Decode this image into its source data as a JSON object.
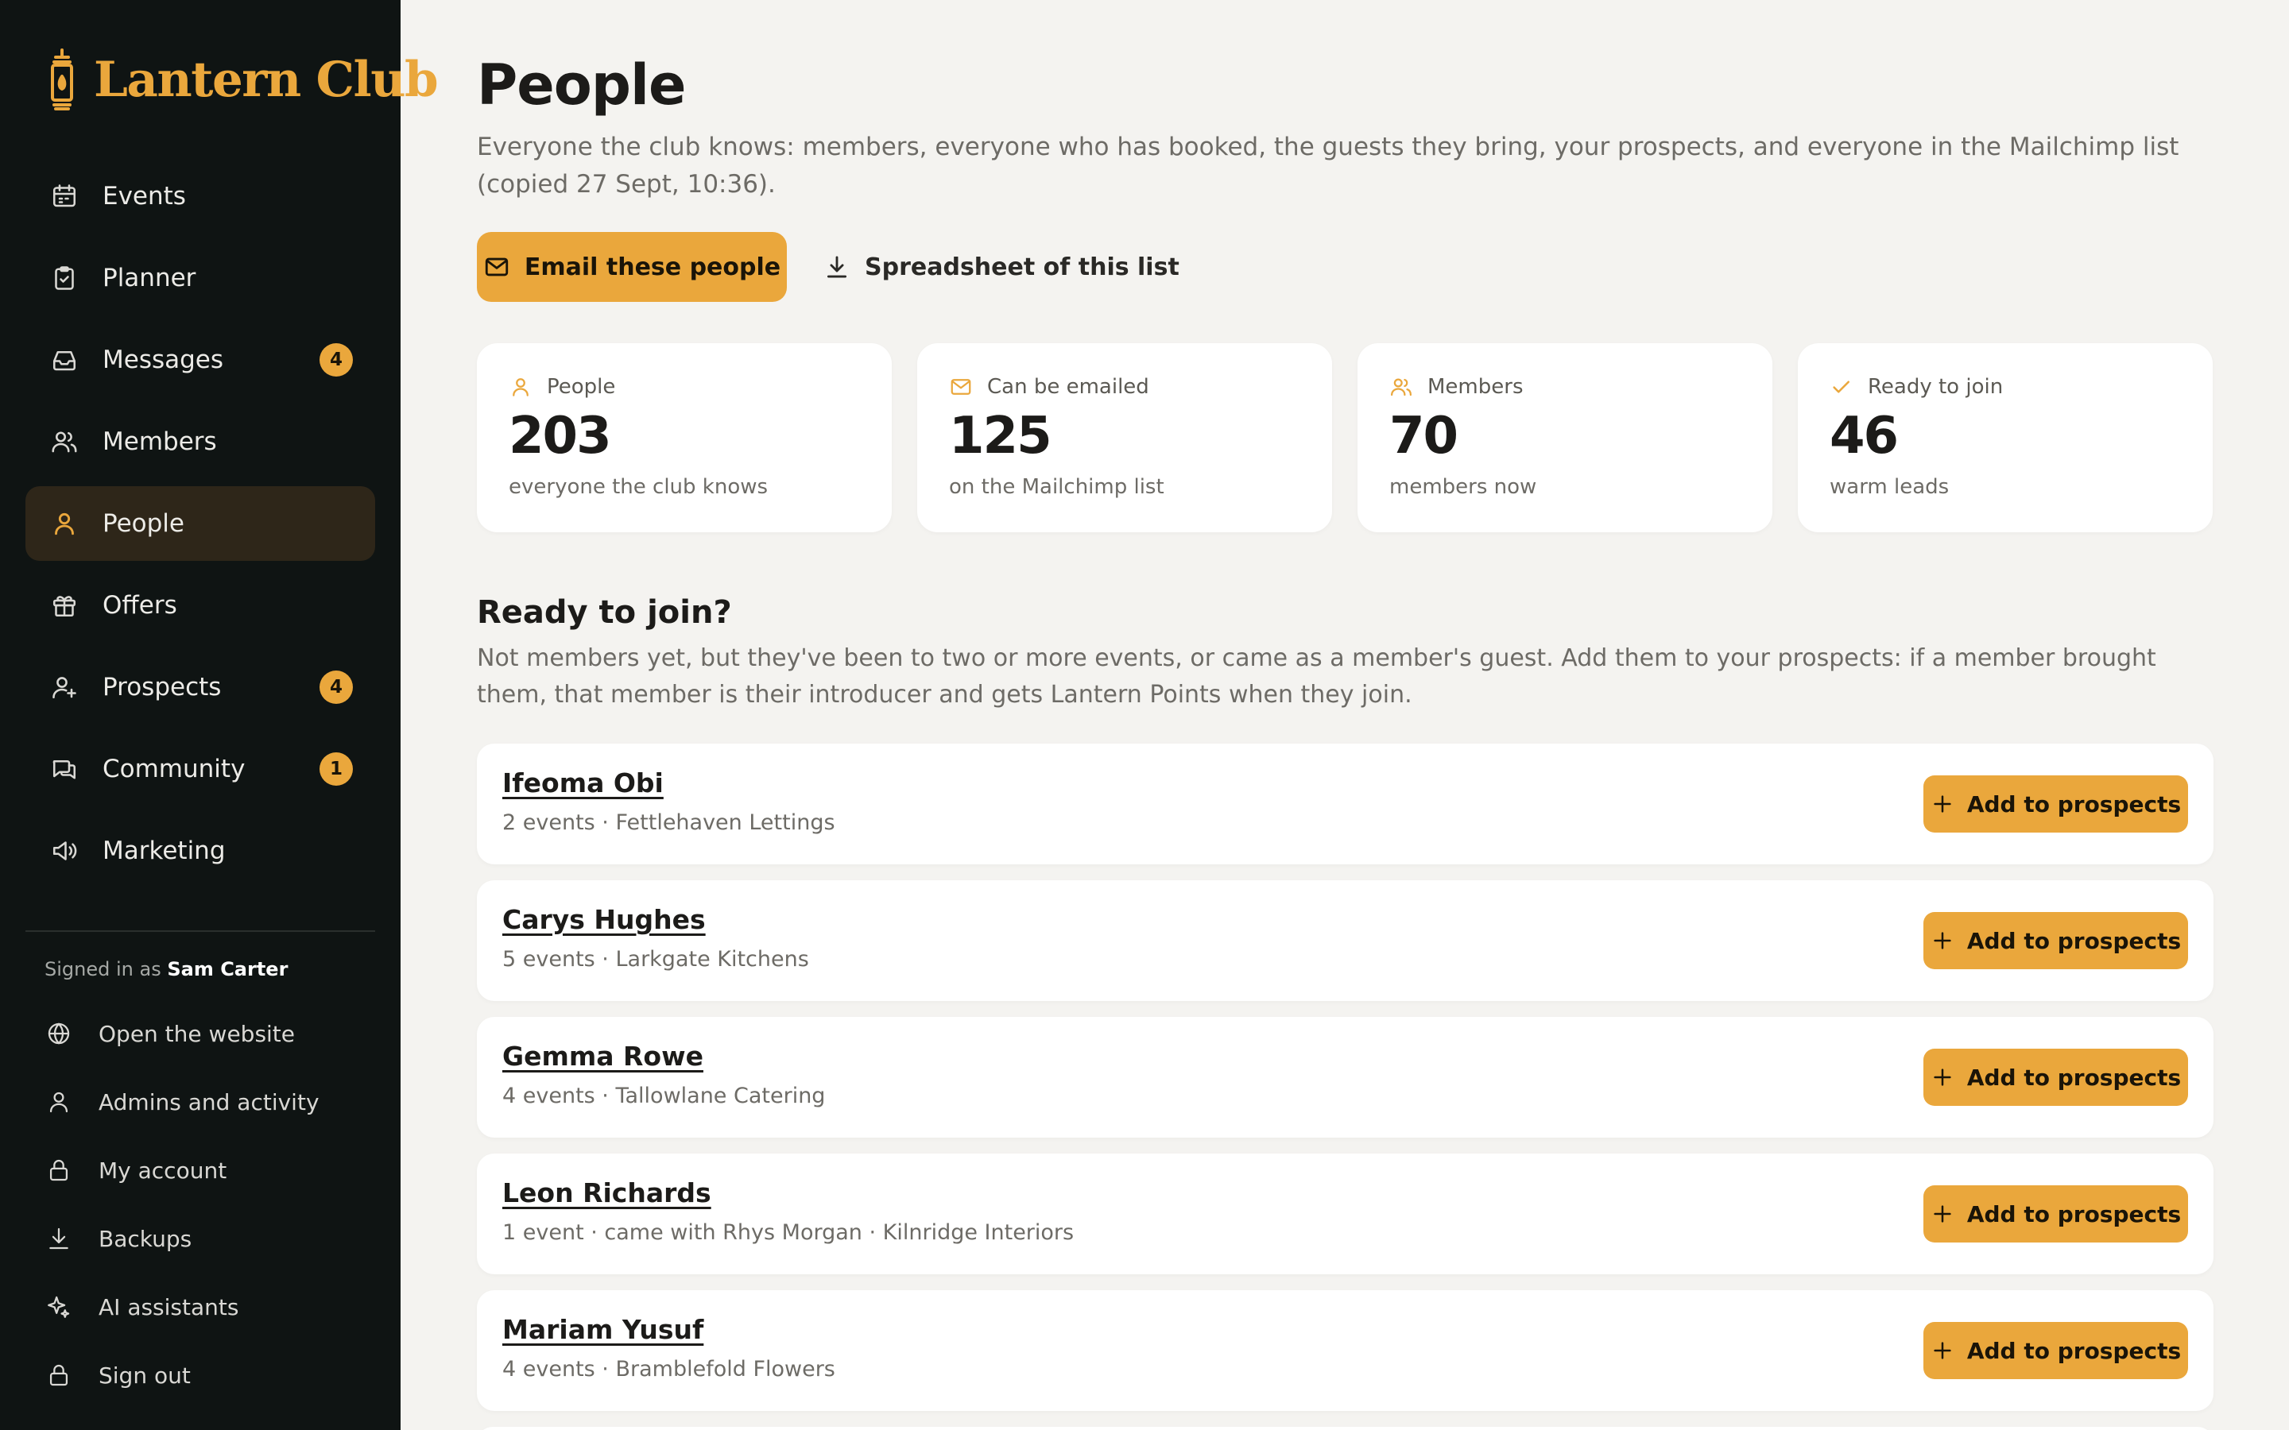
{
  "brand": {
    "name": "Lantern Club"
  },
  "nav": [
    {
      "label": "Events",
      "icon": "calendar-icon",
      "badge": null,
      "active": false
    },
    {
      "label": "Planner",
      "icon": "clipboard-check-icon",
      "badge": null,
      "active": false
    },
    {
      "label": "Messages",
      "icon": "inbox-icon",
      "badge": "4",
      "active": false
    },
    {
      "label": "Members",
      "icon": "users-icon",
      "badge": null,
      "active": false
    },
    {
      "label": "People",
      "icon": "user-icon",
      "badge": null,
      "active": true
    },
    {
      "label": "Offers",
      "icon": "gift-icon",
      "badge": null,
      "active": false
    },
    {
      "label": "Prospects",
      "icon": "user-plus-icon",
      "badge": "4",
      "active": false
    },
    {
      "label": "Community",
      "icon": "chat-icon",
      "badge": "1",
      "active": false
    },
    {
      "label": "Marketing",
      "icon": "megaphone-icon",
      "badge": null,
      "active": false
    }
  ],
  "account": {
    "signed_in_prefix": "Signed in as",
    "user_name": "Sam Carter",
    "items": [
      {
        "label": "Open the website",
        "icon": "globe-icon"
      },
      {
        "label": "Admins and activity",
        "icon": "user-icon"
      },
      {
        "label": "My account",
        "icon": "lock-icon"
      },
      {
        "label": "Backups",
        "icon": "download-icon"
      },
      {
        "label": "AI assistants",
        "icon": "sparkle-icon"
      },
      {
        "label": "Sign out",
        "icon": "lock-icon"
      }
    ]
  },
  "page": {
    "title": "People",
    "description": "Everyone the club knows: members, everyone who has booked, the guests they bring, your prospects, and everyone in the Mailchimp list (copied 27 Sept, 10:36).",
    "email_button": "Email these people",
    "spreadsheet_button": "Spreadsheet of this list"
  },
  "stats": [
    {
      "label": "People",
      "value": "203",
      "caption": "everyone the club knows",
      "icon": "user-icon"
    },
    {
      "label": "Can be emailed",
      "value": "125",
      "caption": "on the Mailchimp list",
      "icon": "mail-icon"
    },
    {
      "label": "Members",
      "value": "70",
      "caption": "members now",
      "icon": "users-icon"
    },
    {
      "label": "Ready to join",
      "value": "46",
      "caption": "warm leads",
      "icon": "check-icon"
    }
  ],
  "ready": {
    "title": "Ready to join?",
    "description": "Not members yet, but they've been to two or more events, or came as a member's guest. Add them to your prospects: if a member brought them, that member is their introducer and gets Lantern Points when they join.",
    "add_label": "Add to prospects",
    "people": [
      {
        "name": "Ifeoma Obi",
        "meta": "2 events · Fettlehaven Lettings"
      },
      {
        "name": "Carys Hughes",
        "meta": "5 events · Larkgate Kitchens"
      },
      {
        "name": "Gemma Rowe",
        "meta": "4 events · Tallowlane Catering"
      },
      {
        "name": "Leon Richards",
        "meta": "1 event · came with Rhys Morgan · Kilnridge Interiors"
      },
      {
        "name": "Mariam Yusuf",
        "meta": "4 events · Bramblefold Flowers"
      }
    ]
  },
  "colors": {
    "accent": "#eaa73c",
    "sidebar": "#0f1413",
    "background": "#f4f3f0"
  }
}
